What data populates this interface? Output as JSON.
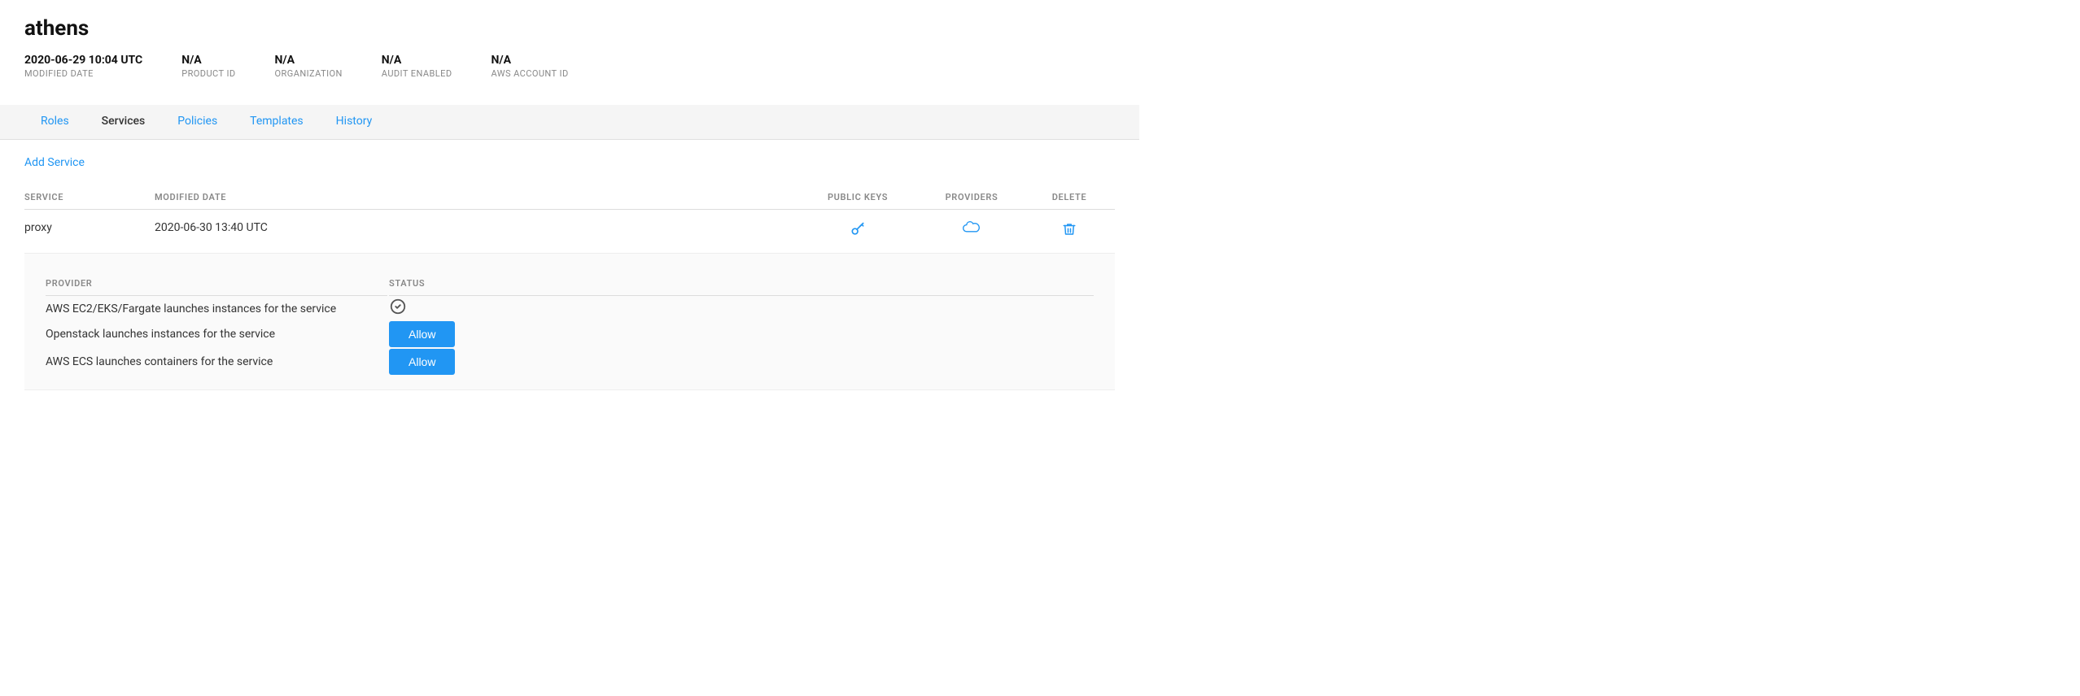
{
  "app": {
    "title": "athens"
  },
  "meta": {
    "modified_date": {
      "value": "2020-06-29 10:04 UTC",
      "label": "MODIFIED DATE"
    },
    "product_id": {
      "value": "N/A",
      "label": "PRODUCT ID"
    },
    "organization": {
      "value": "N/A",
      "label": "ORGANIZATION"
    },
    "audit_enabled": {
      "value": "N/A",
      "label": "AUDIT ENABLED"
    },
    "aws_account_id": {
      "value": "N/A",
      "label": "AWS ACCOUNT ID"
    }
  },
  "tabs": [
    {
      "id": "roles",
      "label": "Roles",
      "active": false
    },
    {
      "id": "services",
      "label": "Services",
      "active": true
    },
    {
      "id": "policies",
      "label": "Policies",
      "active": false
    },
    {
      "id": "templates",
      "label": "Templates",
      "active": false
    },
    {
      "id": "history",
      "label": "History",
      "active": false
    }
  ],
  "add_service_label": "Add Service",
  "table": {
    "columns": {
      "service": "SERVICE",
      "modified_date": "MODIFIED DATE",
      "public_keys": "PUBLIC KEYS",
      "providers": "PROVIDERS",
      "delete": "DELETE"
    },
    "rows": [
      {
        "service_name": "proxy",
        "modified_date": "2020-06-30 13:40 UTC"
      }
    ]
  },
  "provider_table": {
    "columns": {
      "provider": "PROVIDER",
      "status": "STATUS"
    },
    "rows": [
      {
        "provider": "AWS EC2/EKS/Fargate launches instances for the service",
        "status": "check"
      },
      {
        "provider": "Openstack launches instances for the service",
        "status": "allow"
      },
      {
        "provider": "AWS ECS launches containers for the service",
        "status": "allow"
      }
    ]
  },
  "allow_label": "Allow"
}
